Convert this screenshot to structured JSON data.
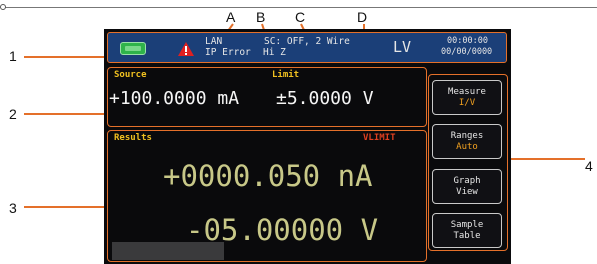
{
  "callouts": {
    "a": "A",
    "b": "B",
    "c": "C",
    "d": "D",
    "n1": "1",
    "n2": "2",
    "n3": "3",
    "n4": "4"
  },
  "topbar": {
    "lan": "LAN",
    "ip_error": "IP Error",
    "hiz": "Hi Z",
    "sc_status": "SC: OFF, 2 Wire",
    "mode": "LV",
    "time": "00:00:00",
    "date": "00/00/0000"
  },
  "source_panel": {
    "source_label": "Source",
    "limit_label": "Limit",
    "source_value": "+100.0000 mA",
    "limit_value": "±5.0000 V"
  },
  "results_panel": {
    "label": "Results",
    "vlimit": "VLIMIT",
    "current": "+0000.050 nA",
    "voltage": "-05.00000 V"
  },
  "softkeys": [
    {
      "top": "Measure",
      "bottom": "I/V"
    },
    {
      "top": "Ranges",
      "bottom": "Auto"
    },
    {
      "top": "Graph",
      "bottom": "View"
    },
    {
      "top": "Sample",
      "bottom": "Table"
    }
  ],
  "colors": {
    "accent": "#e4702a",
    "topbar_bg": "#1b3f78",
    "label_yellow": "#f0c020",
    "vlimit": "#e04020",
    "result_text": "#c8c888",
    "battery": "#2fb34a",
    "warning": "#e02020"
  },
  "icons": [
    "battery-icon",
    "warning-icon"
  ]
}
